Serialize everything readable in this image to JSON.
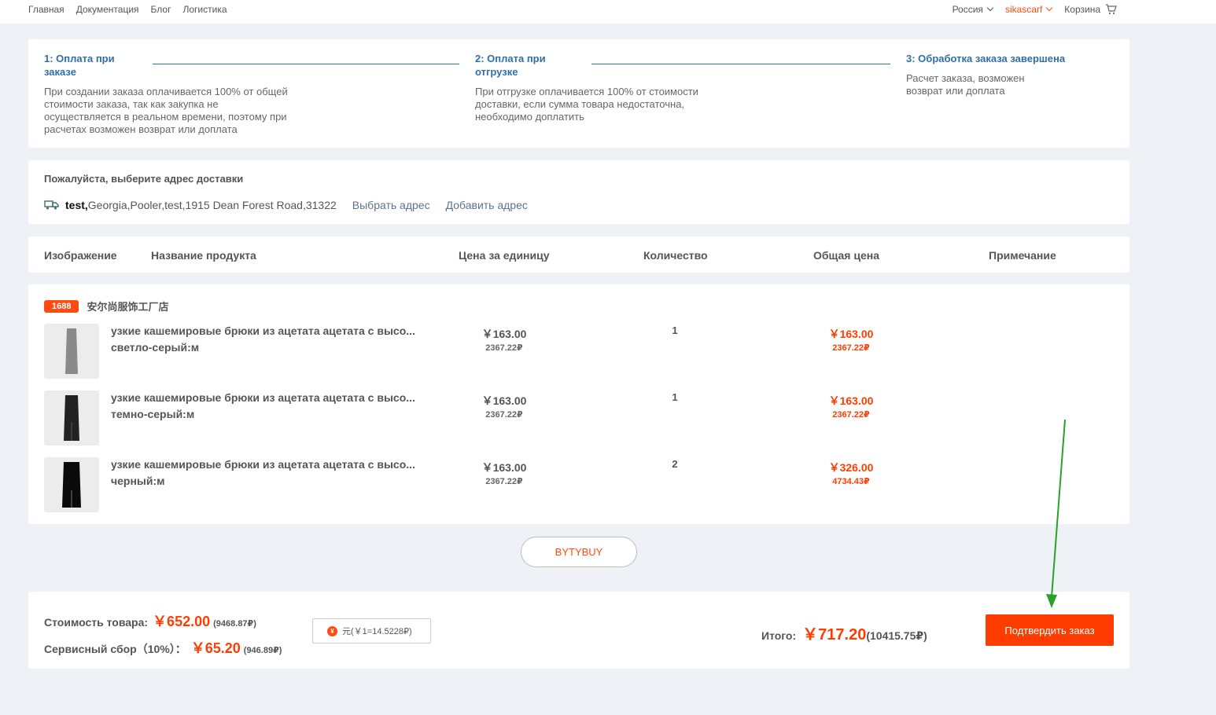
{
  "nav": {
    "home": "Главная",
    "docs": "Документация",
    "blog": "Блог",
    "logistics": "Логистика"
  },
  "topright": {
    "country": "Россия",
    "user": "sikascarf",
    "cart": "Корзина"
  },
  "steps": [
    {
      "title": "1:  Оплата при заказе",
      "desc": "При создании заказа оплачивается 100% от общей стоимости заказа, так как закупка не осуществляется в реальном времени, поэтому при расчетах возможен возврат или доплата"
    },
    {
      "title": "2:  Оплата при отгрузке",
      "desc": "При отгрузке оплачивается 100% от стоимости доставки, если сумма товара недостаточна, необходимо доплатить"
    },
    {
      "title": "3:  Обработка заказа завершена",
      "desc": "Расчет заказа, возможен возврат или доплата"
    }
  ],
  "address": {
    "title": "Пожалуйста, выберите адрес доставки",
    "name": "test,",
    "line": "Georgia,Pooler,test,1915 Dean Forest Road,31322",
    "select": "Выбрать адрес",
    "add": "Добавить адрес"
  },
  "table": {
    "headers": [
      "Изображение",
      "Название продукта",
      "Цена за единицу",
      "Количество",
      "Общая цена",
      "Примечание"
    ]
  },
  "store": {
    "badge": "1688",
    "name": "安尔尚服饰工厂店"
  },
  "products": [
    {
      "name": "узкие кашемировые брюки из ацетата ацетата с высо...",
      "variant": "светло-серый:м",
      "unit_price": "￥163.00",
      "unit_rub": "2367.22₽",
      "qty": "1",
      "total": "￥163.00",
      "total_rub": "2367.22₽",
      "color": "#8a8a8a"
    },
    {
      "name": "узкие кашемировые брюки из ацетата ацетата с высо...",
      "variant": "темно-серый:м",
      "unit_price": "￥163.00",
      "unit_rub": "2367.22₽",
      "qty": "1",
      "total": "￥163.00",
      "total_rub": "2367.22₽",
      "color": "#222222"
    },
    {
      "name": "узкие кашемировые брюки из ацетата ацетата с высо...",
      "variant": "черный:м",
      "unit_price": "￥163.00",
      "unit_rub": "2367.22₽",
      "qty": "2",
      "total": "￥326.00",
      "total_rub": "4734.43₽",
      "color": "#0a0a0a"
    }
  ],
  "promo": "BYTYBUY",
  "summary": {
    "goods_label": "Стоимость товара:",
    "goods_value": "￥652.00",
    "goods_rub": "(9468.87₽)",
    "fee_label": "Сервисный сбор（10%）：",
    "fee_value": "￥65.20",
    "fee_rub": "(946.89₽)",
    "rate_coin": "¥",
    "rate": "元(￥1=14.5228₽)",
    "total_label": "Итого:",
    "total_value": "￥717.20",
    "total_rub": "(10415.75₽)",
    "confirm": "Подтвердить заказ"
  }
}
